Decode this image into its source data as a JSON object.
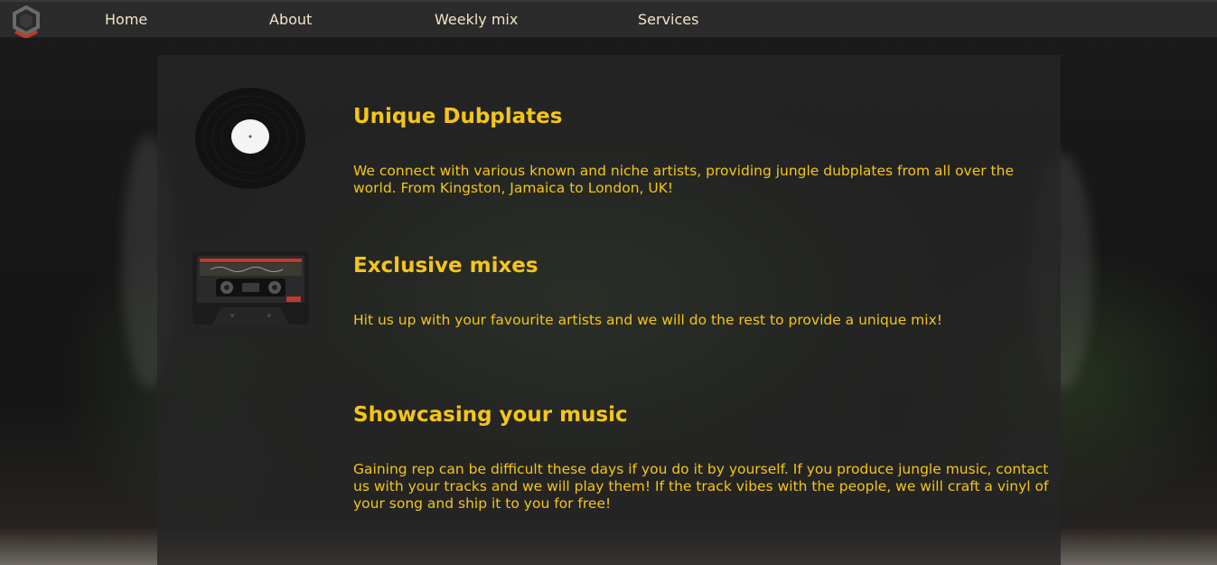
{
  "navbar": {
    "logo_icon": "hexagon-logo-icon",
    "items": [
      {
        "label": "Home"
      },
      {
        "label": "About"
      },
      {
        "label": "Weekly mix"
      },
      {
        "label": "Services"
      }
    ]
  },
  "services": [
    {
      "icon": "vinyl-record-icon",
      "title": "Unique Dubplates",
      "text": "We connect with various known and niche artists, providing jungle dubplates from all over the world. From Kingston, Jamaica to London, UK!"
    },
    {
      "icon": "cassette-tape-icon",
      "title": "Exclusive mixes",
      "text": "Hit us up with your favourite artists and we will do the rest to provide a unique mix!"
    },
    {
      "title": "Showcasing your music",
      "text": "Gaining rep can be difficult these days if you do it by yourself. If you produce jungle music, contact us with your tracks and we will play them! If the track vibes with the people, we will craft a vinyl of your song and ship it to you for free!"
    }
  ],
  "colors": {
    "accent": "#f5c518",
    "nav_text": "#f1e4c8",
    "navbar_bg": "#2b2b2b",
    "logo_red": "#c0392b"
  }
}
